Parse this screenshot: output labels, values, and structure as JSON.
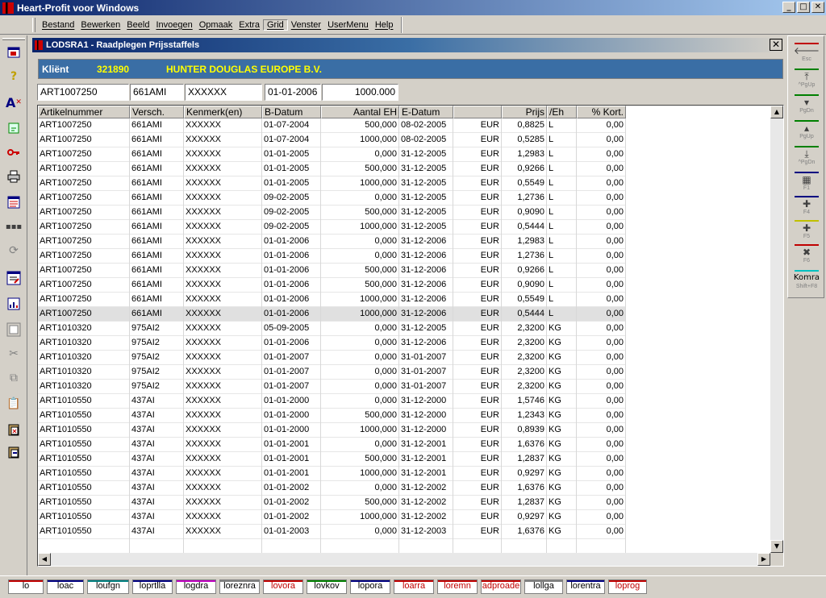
{
  "app": {
    "title": "Heart-Profit voor Windows"
  },
  "titlebar_buttons": [
    "_",
    "□",
    "✕"
  ],
  "menu": [
    "Bestand",
    "Bewerken",
    "Beeld",
    "Invoegen",
    "Opmaak",
    "Extra",
    "Grid",
    "Venster",
    "UserMenu",
    "Help"
  ],
  "window": {
    "title": "LODSRA1 - Raadplegen Prijsstaffels",
    "close": "✕"
  },
  "client": {
    "label": "Kliënt",
    "number": "321890",
    "name": "HUNTER DOUGLAS EUROPE B.V."
  },
  "filters": [
    "ART1007250",
    "661AMI",
    "XXXXXX",
    "01-01-2006",
    "1000.000"
  ],
  "grid": {
    "columns": [
      "Artikelnummer",
      "Versch.",
      "Kenmerk(en)",
      "B-Datum",
      "Aantal EH",
      "E-Datum",
      "",
      "Prijs",
      "/Eh",
      "% Kort."
    ],
    "rows": [
      [
        "ART1007250",
        "661AMI",
        "XXXXXX",
        "01-07-2004",
        "500,000",
        "08-02-2005",
        "EUR",
        "0,8825",
        "L",
        "0,00"
      ],
      [
        "ART1007250",
        "661AMI",
        "XXXXXX",
        "01-07-2004",
        "1000,000",
        "08-02-2005",
        "EUR",
        "0,5285",
        "L",
        "0,00"
      ],
      [
        "ART1007250",
        "661AMI",
        "XXXXXX",
        "01-01-2005",
        "0,000",
        "31-12-2005",
        "EUR",
        "1,2983",
        "L",
        "0,00"
      ],
      [
        "ART1007250",
        "661AMI",
        "XXXXXX",
        "01-01-2005",
        "500,000",
        "31-12-2005",
        "EUR",
        "0,9266",
        "L",
        "0,00"
      ],
      [
        "ART1007250",
        "661AMI",
        "XXXXXX",
        "01-01-2005",
        "1000,000",
        "31-12-2005",
        "EUR",
        "0,5549",
        "L",
        "0,00"
      ],
      [
        "ART1007250",
        "661AMI",
        "XXXXXX",
        "09-02-2005",
        "0,000",
        "31-12-2005",
        "EUR",
        "1,2736",
        "L",
        "0,00"
      ],
      [
        "ART1007250",
        "661AMI",
        "XXXXXX",
        "09-02-2005",
        "500,000",
        "31-12-2005",
        "EUR",
        "0,9090",
        "L",
        "0,00"
      ],
      [
        "ART1007250",
        "661AMI",
        "XXXXXX",
        "09-02-2005",
        "1000,000",
        "31-12-2005",
        "EUR",
        "0,5444",
        "L",
        "0,00"
      ],
      [
        "ART1007250",
        "661AMI",
        "XXXXXX",
        "01-01-2006",
        "0,000",
        "31-12-2006",
        "EUR",
        "1,2983",
        "L",
        "0,00"
      ],
      [
        "ART1007250",
        "661AMI",
        "XXXXXX",
        "01-01-2006",
        "0,000",
        "31-12-2006",
        "EUR",
        "1,2736",
        "L",
        "0,00"
      ],
      [
        "ART1007250",
        "661AMI",
        "XXXXXX",
        "01-01-2006",
        "500,000",
        "31-12-2006",
        "EUR",
        "0,9266",
        "L",
        "0,00"
      ],
      [
        "ART1007250",
        "661AMI",
        "XXXXXX",
        "01-01-2006",
        "500,000",
        "31-12-2006",
        "EUR",
        "0,9090",
        "L",
        "0,00"
      ],
      [
        "ART1007250",
        "661AMI",
        "XXXXXX",
        "01-01-2006",
        "1000,000",
        "31-12-2006",
        "EUR",
        "0,5549",
        "L",
        "0,00"
      ],
      [
        "ART1007250",
        "661AMI",
        "XXXXXX",
        "01-01-2006",
        "1000,000",
        "31-12-2006",
        "EUR",
        "0,5444",
        "L",
        "0,00"
      ],
      [
        "ART1010320",
        "975AI2",
        "XXXXXX",
        "05-09-2005",
        "0,000",
        "31-12-2005",
        "EUR",
        "2,3200",
        "KG",
        "0,00"
      ],
      [
        "ART1010320",
        "975AI2",
        "XXXXXX",
        "01-01-2006",
        "0,000",
        "31-12-2006",
        "EUR",
        "2,3200",
        "KG",
        "0,00"
      ],
      [
        "ART1010320",
        "975AI2",
        "XXXXXX",
        "01-01-2007",
        "0,000",
        "31-01-2007",
        "EUR",
        "2,3200",
        "KG",
        "0,00"
      ],
      [
        "ART1010320",
        "975AI2",
        "XXXXXX",
        "01-01-2007",
        "0,000",
        "31-01-2007",
        "EUR",
        "2,3200",
        "KG",
        "0,00"
      ],
      [
        "ART1010320",
        "975AI2",
        "XXXXXX",
        "01-01-2007",
        "0,000",
        "31-01-2007",
        "EUR",
        "2,3200",
        "KG",
        "0,00"
      ],
      [
        "ART1010550",
        "437AI",
        "XXXXXX",
        "01-01-2000",
        "0,000",
        "31-12-2000",
        "EUR",
        "1,5746",
        "KG",
        "0,00"
      ],
      [
        "ART1010550",
        "437AI",
        "XXXXXX",
        "01-01-2000",
        "500,000",
        "31-12-2000",
        "EUR",
        "1,2343",
        "KG",
        "0,00"
      ],
      [
        "ART1010550",
        "437AI",
        "XXXXXX",
        "01-01-2000",
        "1000,000",
        "31-12-2000",
        "EUR",
        "0,8939",
        "KG",
        "0,00"
      ],
      [
        "ART1010550",
        "437AI",
        "XXXXXX",
        "01-01-2001",
        "0,000",
        "31-12-2001",
        "EUR",
        "1,6376",
        "KG",
        "0,00"
      ],
      [
        "ART1010550",
        "437AI",
        "XXXXXX",
        "01-01-2001",
        "500,000",
        "31-12-2001",
        "EUR",
        "1,2837",
        "KG",
        "0,00"
      ],
      [
        "ART1010550",
        "437AI",
        "XXXXXX",
        "01-01-2001",
        "1000,000",
        "31-12-2001",
        "EUR",
        "0,9297",
        "KG",
        "0,00"
      ],
      [
        "ART1010550",
        "437AI",
        "XXXXXX",
        "01-01-2002",
        "0,000",
        "31-12-2002",
        "EUR",
        "1,6376",
        "KG",
        "0,00"
      ],
      [
        "ART1010550",
        "437AI",
        "XXXXXX",
        "01-01-2002",
        "500,000",
        "31-12-2002",
        "EUR",
        "1,2837",
        "KG",
        "0,00"
      ],
      [
        "ART1010550",
        "437AI",
        "XXXXXX",
        "01-01-2002",
        "1000,000",
        "31-12-2002",
        "EUR",
        "0,9297",
        "KG",
        "0,00"
      ],
      [
        "ART1010550",
        "437AI",
        "XXXXXX",
        "01-01-2003",
        "0,000",
        "31-12-2003",
        "EUR",
        "1,6376",
        "KG",
        "0,00"
      ]
    ],
    "selected_row": 13
  },
  "right_toolbar": [
    {
      "key": "Esc",
      "icon": "arrow-left-icon",
      "color": "#c00000"
    },
    {
      "key": "^PgUp",
      "icon": "first-page-icon",
      "color": "#008000"
    },
    {
      "key": "PgDn",
      "icon": "page-down-icon",
      "color": "#008000"
    },
    {
      "key": "PgUp",
      "icon": "page-up-icon",
      "color": "#008000"
    },
    {
      "key": "^PgDn",
      "icon": "last-page-icon",
      "color": "#008000"
    },
    {
      "key": "F1",
      "icon": "calculator-icon",
      "color": "#000080"
    },
    {
      "key": "F4",
      "icon": "plus-icon",
      "color": "#000080"
    },
    {
      "key": "F5",
      "icon": "copy-plus-icon",
      "color": "#c0c000"
    },
    {
      "key": "F6",
      "icon": "delete-icon",
      "color": "#c00000"
    },
    {
      "key": "Shift+F8",
      "label": "Komra",
      "color": "#00c0c0"
    }
  ],
  "left_toolbar": [
    "window-icon",
    "help-icon",
    "spell-icon",
    "calendar-icon",
    "key-icon",
    "print-icon",
    "form-icon",
    "dots-icon",
    "refresh-icon",
    "edit-form-icon",
    "chart-icon",
    "frame-icon",
    "cut-icon",
    "copy-icon",
    "paste-icon",
    "paste-special-icon",
    "paste-link-icon"
  ],
  "status_tabs": [
    {
      "label": "lo",
      "color": "#c00000"
    },
    {
      "label": "loac",
      "color": "#000080"
    },
    {
      "label": "loufgn",
      "color": "#008080"
    },
    {
      "label": "loprtlla",
      "color": "#000080"
    },
    {
      "label": "logdra",
      "color": "#c000c0"
    },
    {
      "label": "loreznra",
      "color": "#808080"
    },
    {
      "label": "lovora",
      "color": "#c00000"
    },
    {
      "label": "lovkov",
      "color": "#008000"
    },
    {
      "label": "lopora",
      "color": "#000080"
    },
    {
      "label": "loarra",
      "color": "#c00000"
    },
    {
      "label": "loremn",
      "color": "#c00000"
    },
    {
      "label": "adproade",
      "color": "#c00000"
    },
    {
      "label": "lollga",
      "color": "#808080"
    },
    {
      "label": "lorentra",
      "color": "#000080"
    },
    {
      "label": "loprog",
      "color": "#c00000"
    }
  ]
}
